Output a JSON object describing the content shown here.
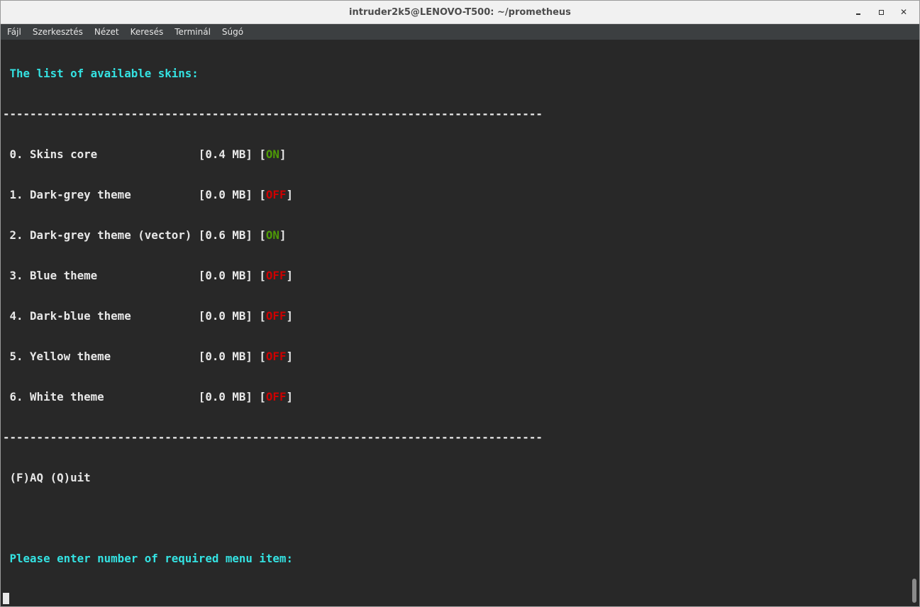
{
  "window": {
    "title": "intruder2k5@LENOVO-T500: ~/prometheus",
    "controls": {
      "minimize": "minimize-icon",
      "maximize": "maximize-icon",
      "close": "close-icon"
    }
  },
  "menubar": {
    "items": [
      {
        "label": "Fájl"
      },
      {
        "label": "Szerkesztés"
      },
      {
        "label": "Nézet"
      },
      {
        "label": "Keresés"
      },
      {
        "label": "Terminál"
      },
      {
        "label": "Súgó"
      }
    ]
  },
  "terminal": {
    "heading": "The list of available skins:",
    "separator": "--------------------------------------------------------------------------------",
    "skins": [
      {
        "prefix": "0. Skins core               [0.4 MB] [",
        "status": "ON",
        "suffix": "]"
      },
      {
        "prefix": "1. Dark-grey theme          [0.0 MB] [",
        "status": "OFF",
        "suffix": "]"
      },
      {
        "prefix": "2. Dark-grey theme (vector) [0.6 MB] [",
        "status": "ON",
        "suffix": "]"
      },
      {
        "prefix": "3. Blue theme               [0.0 MB] [",
        "status": "OFF",
        "suffix": "]"
      },
      {
        "prefix": "4. Dark-blue theme          [0.0 MB] [",
        "status": "OFF",
        "suffix": "]"
      },
      {
        "prefix": "5. Yellow theme             [0.0 MB] [",
        "status": "OFF",
        "suffix": "]"
      },
      {
        "prefix": "6. White theme              [0.0 MB] [",
        "status": "OFF",
        "suffix": "]"
      }
    ],
    "options": "(F)AQ (Q)uit",
    "prompt": "Please enter number of required menu item:"
  },
  "colors": {
    "heading": "#34e2e2",
    "on": "#4e9a06",
    "off": "#cc0000",
    "background": "#282828",
    "foreground": "#e8e8e8"
  }
}
